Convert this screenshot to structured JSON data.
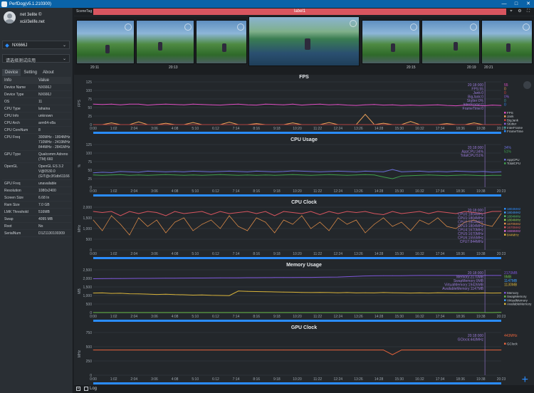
{
  "window": {
    "title": "PerfDog(v5.1.210300)"
  },
  "user": {
    "name": "net 3elite ©",
    "email": "xcii/3elife.net"
  },
  "device_select": {
    "value": "NX666J"
  },
  "app_select": {
    "value": "请选择测试应用"
  },
  "tabs": [
    "Device",
    "Setting",
    "About"
  ],
  "info": {
    "header": {
      "info": "Info",
      "value": "Value"
    },
    "rows": [
      {
        "k": "Device Name",
        "v": "NX666J"
      },
      {
        "k": "Device Type",
        "v": "NX666J"
      },
      {
        "k": "OS",
        "v": "11"
      },
      {
        "k": "CPU Type",
        "v": "lahaina"
      },
      {
        "k": "CPU Info",
        "v": "unknown"
      },
      {
        "k": "CPU Arch",
        "v": "arm64-v8a"
      },
      {
        "k": "CPU CoreNum",
        "v": "8"
      },
      {
        "k": "CPU Freq",
        "v": "300MHz - 1804MHz\n710MHz - 2419MHz\n844MHz - 2841MHz"
      },
      {
        "k": "GPU Type",
        "v": "Qualcomm Adreno\n(TM) 660"
      },
      {
        "k": "OpenGL",
        "v": "OpenGL ES 3.2\nV@0530.0\n(GIT@c3f1db61166"
      },
      {
        "k": "GPU Freq",
        "v": "unavailable"
      },
      {
        "k": "Resolution",
        "v": "1080x2400"
      },
      {
        "k": "Screen Size",
        "v": "6.68 In"
      },
      {
        "k": "Ram Size",
        "v": "7.0 GB"
      },
      {
        "k": "LMK Threshold",
        "v": "516MB"
      },
      {
        "k": "Swap",
        "v": "4095 MB"
      },
      {
        "k": "Root",
        "v": "No"
      },
      {
        "k": "SerialNum",
        "v": "D1Z1130100309"
      }
    ]
  },
  "scene": {
    "label": "SceneTag",
    "tag": "label1"
  },
  "thumbs": [
    "20:11",
    "20:13",
    "20:15",
    "20:19",
    "20:21"
  ],
  "footer": {
    "log": "Log"
  },
  "time_ticks": [
    "0:00",
    "1:02",
    "2:04",
    "3:06",
    "4:08",
    "5:10",
    "6:12",
    "7:14",
    "8:16",
    "9:18",
    "10:20",
    "11:22",
    "12:24",
    "13:26",
    "14:28",
    "15:30",
    "16:32",
    "17:34",
    "18:36",
    "19:38",
    "20:23"
  ],
  "colors": {
    "accent": "#2a8cff",
    "tag": "#d8555f",
    "fps": "#e04fc4",
    "appcpu": "#6a6fd8",
    "totalcpu": "#3fa04d",
    "gpu": "#e8643c",
    "mem": "#d8b33a",
    "swap": "#7d56d8"
  },
  "chart_data": [
    {
      "type": "line",
      "title": "FPS",
      "ylabel": "FPS",
      "ylim": [
        0,
        125
      ],
      "yticks": [
        "0",
        "25",
        "50",
        "75",
        "100",
        "125"
      ],
      "series": [
        {
          "name": "FPS",
          "values": [
            60,
            59,
            60,
            58,
            60,
            60,
            57,
            59,
            60,
            59,
            58,
            60,
            59,
            58,
            57,
            59,
            60,
            58,
            57,
            60,
            59,
            58,
            60,
            57,
            59,
            60,
            58,
            59,
            57,
            56,
            58,
            59,
            57,
            58,
            56,
            57,
            56,
            57,
            58,
            56,
            55,
            57,
            56,
            55,
            57,
            56
          ]
        },
        {
          "name": "Jank",
          "values": [
            0,
            0,
            5,
            0,
            0,
            8,
            0,
            0,
            4,
            0,
            0,
            6,
            0,
            0,
            0,
            7,
            0,
            0,
            3,
            0,
            0,
            0,
            5,
            0,
            0,
            0,
            6,
            0,
            0,
            0,
            30,
            0,
            4,
            0,
            0,
            9,
            0,
            0,
            0,
            3,
            0,
            0,
            5,
            0,
            0,
            0
          ]
        },
        {
          "name": "BigJank",
          "values": [
            0,
            0,
            0,
            0,
            0,
            0,
            0,
            0,
            0,
            0,
            0,
            0,
            0,
            0,
            0,
            0,
            0,
            0,
            0,
            0,
            0,
            0,
            0,
            0,
            0,
            0,
            0,
            0,
            0,
            0,
            0,
            0,
            0,
            0,
            0,
            0,
            0,
            0,
            0,
            0,
            0,
            0,
            0,
            0,
            0,
            0
          ]
        }
      ],
      "readout": [
        "20:18:000",
        "FPS:55",
        "Jank:0",
        "BigJank:0",
        "Stutter:0%",
        "InterFrame:0",
        "FrameTime:0"
      ],
      "legend": [
        "FPS",
        "Jank",
        "BigJank",
        "Stutter",
        "InterFrame",
        "FrameTime"
      ],
      "current": [
        "55",
        "0",
        "0",
        "0%",
        "0",
        "0"
      ]
    },
    {
      "type": "line",
      "title": "CPU Usage",
      "ylabel": "%",
      "ylim": [
        0,
        125
      ],
      "yticks": [
        "0",
        "25",
        "50",
        "75",
        "100",
        "125"
      ],
      "series": [
        {
          "name": "AppCPU",
          "values": [
            42,
            44,
            43,
            46,
            45,
            44,
            47,
            46,
            45,
            46,
            45,
            47,
            46,
            45,
            46,
            47,
            46,
            45,
            47,
            46,
            45,
            46,
            48,
            47,
            46,
            45,
            46,
            47,
            46,
            45,
            47,
            46,
            45,
            52,
            45,
            46,
            47,
            45,
            46,
            45,
            47,
            46,
            45,
            46,
            44,
            45
          ]
        },
        {
          "name": "TotalCPU",
          "values": [
            36,
            35,
            36,
            37,
            35,
            36,
            35,
            36,
            37,
            36,
            35,
            36,
            35,
            36,
            37,
            36,
            35,
            36,
            35,
            36,
            35,
            36,
            37,
            36,
            35,
            36,
            37,
            36,
            35,
            36,
            37,
            36,
            30,
            25,
            33,
            34,
            35,
            36,
            35,
            34,
            35,
            36,
            35,
            34,
            35,
            35
          ]
        }
      ],
      "readout": [
        "20:18:000",
        "AppCPU:34%",
        "TotalCPU:51%"
      ],
      "legend": [
        "AppCPU",
        "TotalCPU"
      ],
      "current": [
        "34%",
        "51%"
      ]
    },
    {
      "type": "line",
      "title": "CPU Clock",
      "ylabel": "MHz",
      "ylim": [
        0,
        2000
      ],
      "yticks": [
        "0",
        "500",
        "1,000",
        "1,500",
        "2,000"
      ],
      "series": [
        {
          "name": "CPU0",
          "values": [
            1800,
            1750,
            1800,
            1600,
            1800,
            1700,
            1800,
            1750,
            1600,
            1800,
            1700,
            1750,
            1800,
            1650,
            1800,
            1700,
            1750,
            1800,
            1700,
            1800,
            1600,
            1800,
            1750,
            1700,
            1800,
            1650,
            1800,
            1700,
            1800,
            1750,
            1800,
            1700,
            1650,
            1800,
            1700,
            1750,
            1800,
            1700,
            1800,
            1750,
            1700,
            1800,
            1750,
            1700,
            1800,
            1804
          ]
        },
        {
          "name": "CPU4",
          "values": [
            1400,
            900,
            1600,
            1200,
            700,
            1500,
            1100,
            1400,
            800,
            1300,
            1500,
            900,
            1200,
            1400,
            1000,
            1600,
            1100,
            900,
            1500,
            1300,
            800,
            1400,
            1200,
            1600,
            1000,
            1300,
            900,
            1500,
            1200,
            1400,
            800,
            1200,
            1500,
            1100,
            1300,
            900,
            1400,
            1200,
            1500,
            1100,
            1000,
            1300,
            1400,
            1200,
            1100,
            1700
          ]
        }
      ],
      "readout": [
        "20:18:000",
        "CPU0:1804MHz",
        "CPU1:1804MHz",
        "CPU2:1804MHz",
        "CPU3:1804MHz",
        "CPU4:1670MHz",
        "CPU5:1670MHz",
        "CPU6:1555MHz",
        "CPU7:844MHz"
      ],
      "legend": [
        "1804MHz",
        "1804MHz",
        "1804MHz",
        "1804MHz",
        "1670MHz",
        "1670MHz",
        "1555MHz",
        "844MHz"
      ]
    },
    {
      "type": "line",
      "title": "Memory Usage",
      "ylabel": "MB",
      "ylim": [
        0,
        2500
      ],
      "yticks": [
        "0",
        "500",
        "1,000",
        "1,500",
        "2,000",
        "2,500"
      ],
      "series": [
        {
          "name": "Memory",
          "values": [
            1980,
            1985,
            1990,
            1990,
            1995,
            2000,
            2000,
            2005,
            2010,
            2010,
            2015,
            2020,
            2020,
            2025,
            2030,
            2030,
            2035,
            2040,
            2040,
            2045,
            2050,
            2050,
            2055,
            2060,
            2060,
            2065,
            2070,
            2080,
            2100,
            2120,
            2140,
            2150,
            2155,
            2160,
            2160,
            2165,
            2170,
            2170,
            2170,
            2170,
            2170,
            2170,
            2170,
            2170,
            2170,
            2170
          ]
        },
        {
          "name": "SwapMemory",
          "values": [
            0,
            0,
            0,
            0,
            0,
            0,
            0,
            0,
            0,
            0,
            0,
            0,
            0,
            0,
            0,
            0,
            0,
            0,
            0,
            0,
            0,
            0,
            0,
            0,
            0,
            0,
            0,
            0,
            0,
            0,
            0,
            0,
            0,
            0,
            0,
            0,
            0,
            0,
            0,
            0,
            0,
            0,
            0,
            0,
            0,
            9
          ]
        },
        {
          "name": "AvailableMemory",
          "values": [
            1140,
            1150,
            1120,
            1130,
            1100,
            1090,
            1080,
            1060,
            1070,
            1050,
            1040,
            1020,
            1030,
            1010,
            1000,
            990,
            1260,
            1240,
            1230,
            1220,
            1210,
            1200,
            1190,
            1180,
            1170,
            1180,
            1170,
            1160,
            1170,
            1150,
            1160,
            1150,
            1170,
            1160,
            1150,
            1140,
            1150,
            1140,
            1160,
            1150,
            1140,
            1150,
            1140,
            1150,
            1140,
            1147
          ]
        }
      ],
      "readout": [
        "20:18:000",
        "Memory:2170MB",
        "SwapMemory:9MB",
        "VirtualMemory:19426MB",
        "AvailableMemory:1147MB"
      ],
      "legend": [
        "Memory",
        "SwapMemory",
        "VirtualMemory",
        "AvailableMemory"
      ],
      "current": [
        "2170MB",
        "9MB",
        "1147MB",
        "1130MB"
      ]
    },
    {
      "type": "line",
      "title": "GPU Clock",
      "ylabel": "MHz",
      "ylim": [
        0,
        750
      ],
      "yticks": [
        "0",
        "250",
        "500",
        "750"
      ],
      "series": [
        {
          "name": "GClock",
          "values": [
            443,
            443,
            443,
            443,
            443,
            443,
            443,
            443,
            443,
            443,
            443,
            443,
            443,
            443,
            443,
            443,
            443,
            443,
            443,
            443,
            443,
            443,
            443,
            443,
            443,
            443,
            443,
            443,
            443,
            443,
            443,
            443,
            443,
            360,
            443,
            443,
            443,
            443,
            443,
            443,
            443,
            443,
            443,
            443,
            443,
            443
          ]
        }
      ],
      "readout": [
        "20:18:000",
        "GClock:443MHz"
      ],
      "legend": [
        "GClock"
      ],
      "current": [
        "443MHz"
      ]
    }
  ]
}
